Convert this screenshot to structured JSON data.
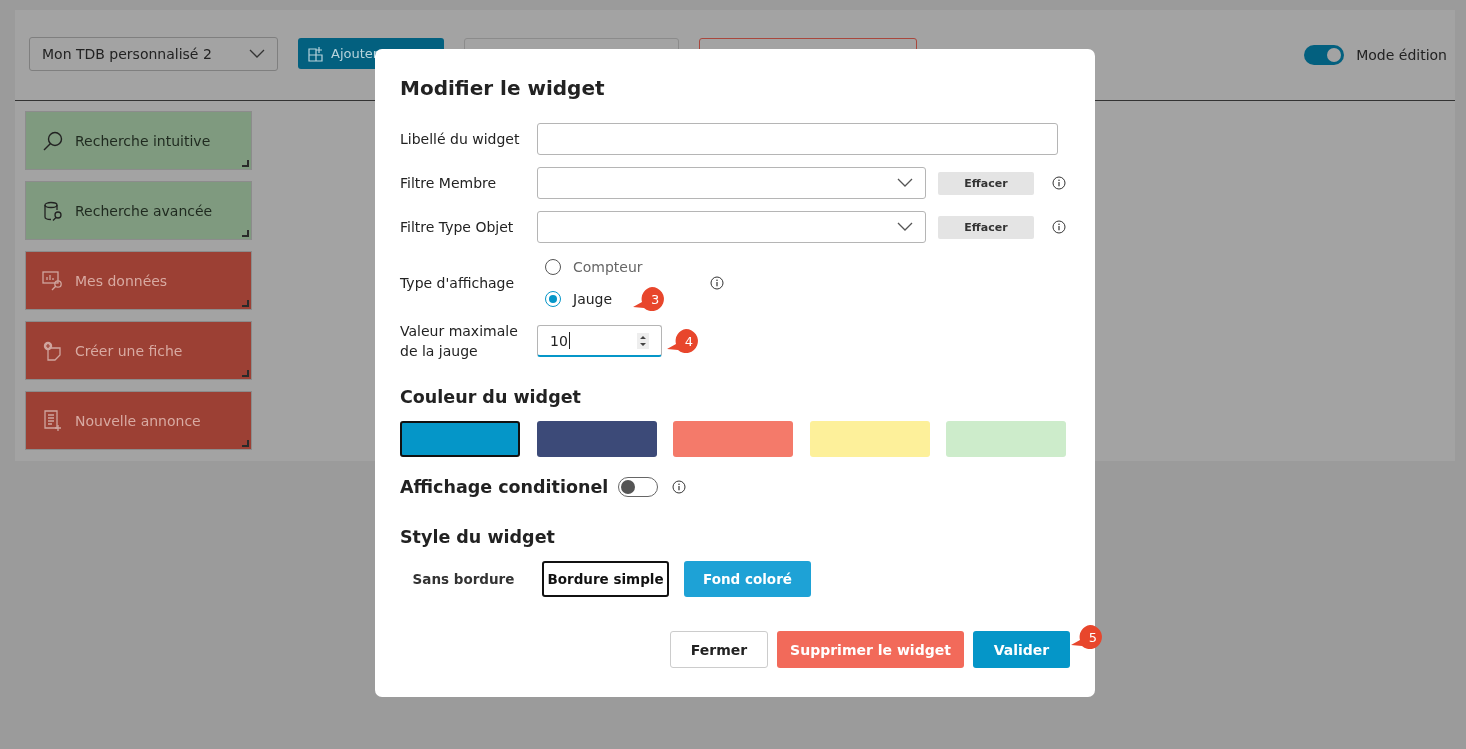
{
  "toolbar": {
    "dashboard_select": {
      "value": "Mon TDB personnalisé 2"
    },
    "buttons": [
      {
        "kind": "primary",
        "label": "Ajouter"
      },
      {
        "kind": "outline"
      },
      {
        "kind": "danger-outline"
      }
    ],
    "edit_mode": {
      "label": "Mode édition",
      "on": true
    }
  },
  "widgets": [
    {
      "label": "Recherche intuitive",
      "kind": "search",
      "color": "#7f9a7f"
    },
    {
      "label": "Recherche avancée",
      "kind": "database",
      "color": "#7f9a7f"
    },
    {
      "label": "Mes données",
      "kind": "chart",
      "color": "#9c4034"
    },
    {
      "label": "Créer une fiche",
      "kind": "new-record",
      "color": "#9c4034"
    },
    {
      "label": "Nouvelle annonce",
      "kind": "list",
      "color": "#9c4034"
    }
  ],
  "dialog": {
    "title": "Modifier le widget",
    "fields": [
      {
        "kind": "text",
        "label": "Libellé du widget"
      },
      {
        "kind": "select",
        "label": "Filtre Membre",
        "button": "Effacer"
      },
      {
        "kind": "select",
        "label": "Filtre Type Objet",
        "button": "Effacer"
      },
      {
        "kind": "radio",
        "label": "Type d'affichage",
        "badge": "3",
        "options": [
          {
            "label": "Compteur",
            "selected": false
          },
          {
            "label": "Jauge",
            "selected": true
          }
        ]
      },
      {
        "kind": "number",
        "label": "Valeur maximale de la jauge",
        "value": "10",
        "badge": "4"
      }
    ],
    "color_section": {
      "title": "Couleur du widget",
      "swatches": [
        {
          "color": "#0596c8",
          "selected": true
        },
        {
          "color": "#3c4a78",
          "selected": false
        },
        {
          "color": "#f47a6a",
          "selected": false
        },
        {
          "color": "#fdf09a",
          "selected": false
        },
        {
          "color": "#cdeccb",
          "selected": false
        }
      ]
    },
    "conditional": {
      "label": "Affichage conditionel",
      "on": false
    },
    "style_section": {
      "title": "Style du widget",
      "options": [
        {
          "label": "Sans bordure",
          "selected": false,
          "focused": false
        },
        {
          "label": "Bordure simple",
          "selected": false,
          "focused": true
        },
        {
          "label": "Fond coloré",
          "selected": true,
          "focused": false
        }
      ]
    },
    "actions": [
      {
        "kind": "secondary",
        "label": "Fermer"
      },
      {
        "kind": "danger",
        "label": "Supprimer le widget"
      },
      {
        "kind": "primary",
        "label": "Valider",
        "badge": "5"
      }
    ]
  }
}
